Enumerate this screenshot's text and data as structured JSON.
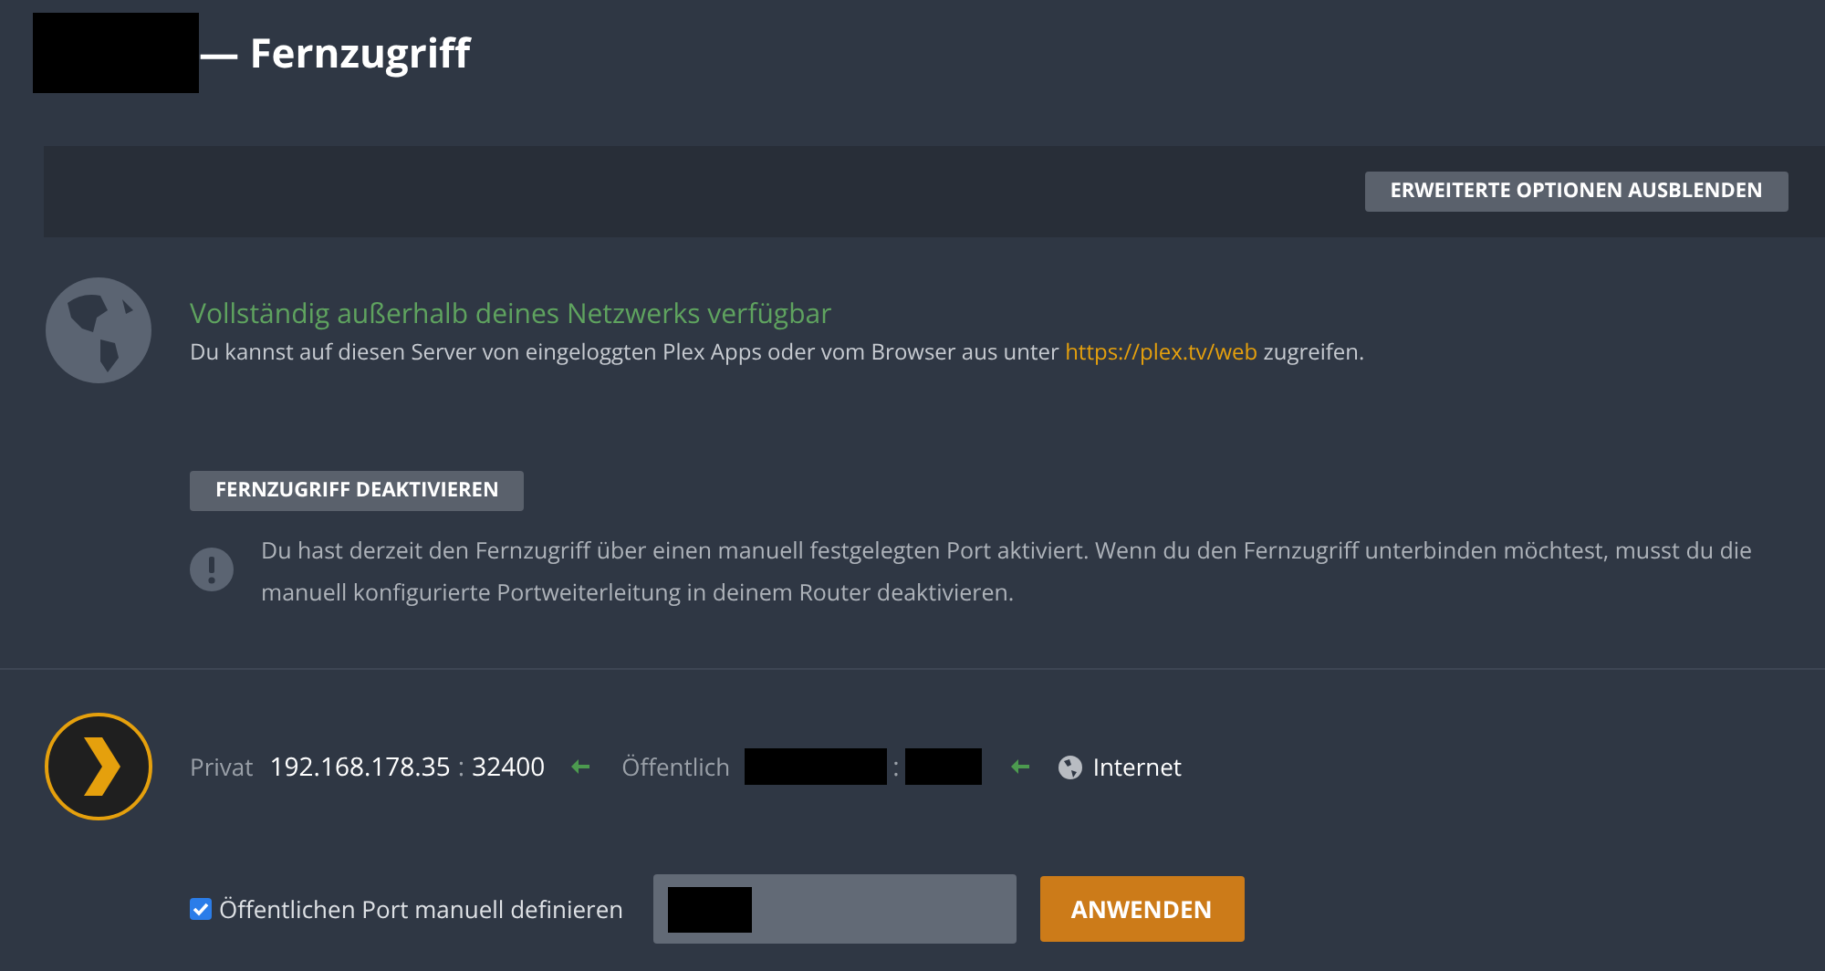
{
  "header": {
    "title": "— Fernzugriff"
  },
  "toolbar": {
    "button": "ERWEITERTE OPTIONEN AUSBLENDEN"
  },
  "status": {
    "heading": "Vollständig außerhalb deines Netzwerks verfügbar",
    "text_before": "Du kannst auf diesen Server von eingeloggten Plex Apps oder vom Browser aus unter",
    "link": "https://plex.tv/web",
    "text_after": "zugreifen."
  },
  "disable_button": "FERNZUGRIFF DEAKTIVIEREN",
  "notice": "Du hast derzeit den Fernzugriff über einen manuell festgelegten Port aktiviert. Wenn du den Fernzugriff unterbinden möchtest, musst du die manuell konfigurierte Portweiterleitung in deinem Router deaktivieren.",
  "connection": {
    "private_label": "Privat",
    "private_ip": "192.168.178.35",
    "separator": ":",
    "private_port": "32400",
    "public_label": "Öffentlich",
    "public_separator": ":",
    "internet_label": "Internet"
  },
  "manual_port": {
    "label": "Öffentlichen Port manuell definieren",
    "checked": true,
    "apply_button": "ANWENDEN"
  }
}
